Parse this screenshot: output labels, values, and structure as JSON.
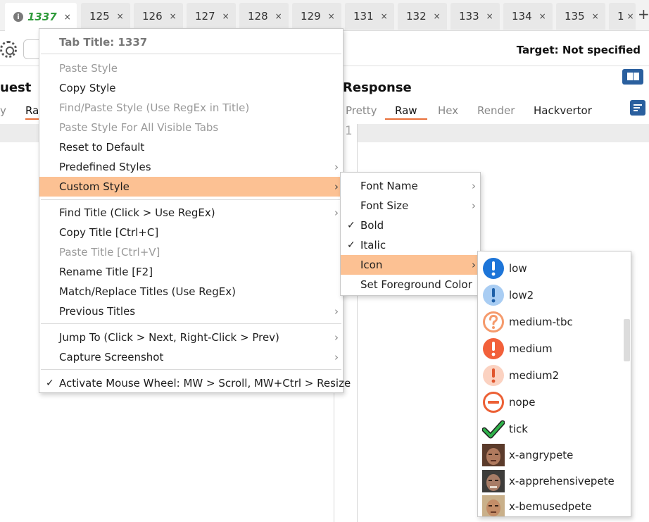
{
  "tabs": [
    {
      "label": "1337",
      "close": "×"
    },
    {
      "label": "125",
      "close": "×"
    },
    {
      "label": "126",
      "close": "×"
    },
    {
      "label": "127",
      "close": "×"
    },
    {
      "label": "128",
      "close": "×"
    },
    {
      "label": "129",
      "close": "×"
    },
    {
      "label": "131",
      "close": "×"
    },
    {
      "label": "132",
      "close": "×"
    },
    {
      "label": "133",
      "close": "×"
    },
    {
      "label": "134",
      "close": "×"
    },
    {
      "label": "135",
      "close": "×"
    },
    {
      "label": "1",
      "close": "×"
    }
  ],
  "tab_info_icon": "i",
  "add_tab": "+",
  "toolbar": {
    "target": "Target: Not specified"
  },
  "request": {
    "title": "uest",
    "subtabs": [
      "y",
      "Ra"
    ]
  },
  "response": {
    "title": "Response",
    "subtabs": [
      "Pretty",
      "Raw",
      "Hex",
      "Render",
      "Hackvertor"
    ],
    "selected": "Raw",
    "line_number": "1"
  },
  "context_menu": {
    "header": "Tab Title: 1337",
    "items": [
      {
        "label": "Paste Style",
        "disabled": true
      },
      {
        "label": "Copy Style"
      },
      {
        "label": "Find/Paste Style (Use RegEx in Title)",
        "disabled": true
      },
      {
        "label": "Paste Style For All Visible Tabs",
        "disabled": true
      },
      {
        "label": "Reset to Default"
      },
      {
        "label": "Predefined Styles",
        "submenu": true
      },
      {
        "label": "Custom Style",
        "submenu": true,
        "highlighted": true
      },
      {
        "label": "Find Title (Click > Use RegEx)",
        "submenu": true
      },
      {
        "label": "Copy Title [Ctrl+C]"
      },
      {
        "label": "Paste Title [Ctrl+V]",
        "disabled": true
      },
      {
        "label": "Rename Title [F2]"
      },
      {
        "label": "Match/Replace Titles (Use RegEx)"
      },
      {
        "label": "Previous Titles",
        "submenu": true
      },
      {
        "label": "Jump To (Click > Next, Right-Click > Prev)",
        "submenu": true
      },
      {
        "label": "Capture Screenshot",
        "submenu": true
      },
      {
        "label": "Activate Mouse Wheel: MW > Scroll, MW+Ctrl > Resize",
        "checked": true
      }
    ]
  },
  "custom_style_menu": {
    "items": [
      {
        "label": "Font Name",
        "submenu": true
      },
      {
        "label": "Font Size",
        "submenu": true
      },
      {
        "label": "Bold",
        "checked": true
      },
      {
        "label": "Italic",
        "checked": true
      },
      {
        "label": "Icon",
        "submenu": true,
        "highlighted": true
      },
      {
        "label": "Set Foreground Color"
      }
    ]
  },
  "icon_menu": {
    "items": [
      {
        "label": "low",
        "icon": "exclamation-blue-icon"
      },
      {
        "label": "low2",
        "icon": "exclamation-lightblue-icon"
      },
      {
        "label": "medium-tbc",
        "icon": "question-orange-outline-icon"
      },
      {
        "label": "medium",
        "icon": "exclamation-orange-icon"
      },
      {
        "label": "medium2",
        "icon": "exclamation-peach-icon"
      },
      {
        "label": "nope",
        "icon": "no-entry-icon"
      },
      {
        "label": "tick",
        "icon": "green-tick-icon"
      },
      {
        "label": "x-angrypete",
        "icon": "face-photo-icon"
      },
      {
        "label": "x-apprehensivepete",
        "icon": "face-photo-icon"
      },
      {
        "label": "x-bemusedpete",
        "icon": "face-photo-icon"
      }
    ]
  },
  "check_glyph": "✓",
  "arrow_glyph": "›",
  "colors": {
    "highlight": "#fcc193",
    "active_tab_text": "#2e9a3a",
    "accent_blue": "#2a5f9e",
    "selected_underline": "#e8703a"
  }
}
